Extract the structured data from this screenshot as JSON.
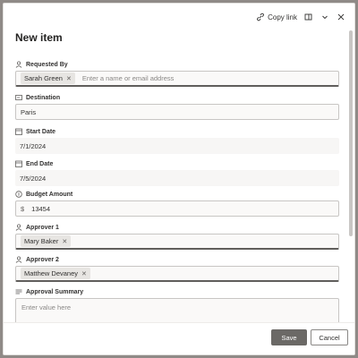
{
  "topbar": {
    "copy_link": "Copy link"
  },
  "form": {
    "title": "New item",
    "requested_by": {
      "label": "Requested By",
      "value": "Sarah Green",
      "placeholder": "Enter a name or email address"
    },
    "destination": {
      "label": "Destination",
      "value": "Paris"
    },
    "start_date": {
      "label": "Start Date",
      "value": "7/1/2024"
    },
    "end_date": {
      "label": "End Date",
      "value": "7/5/2024"
    },
    "budget": {
      "label": "Budget Amount",
      "currency": "$",
      "value": "13454"
    },
    "approver1": {
      "label": "Approver 1",
      "value": "Mary Baker"
    },
    "approver2": {
      "label": "Approver 2",
      "value": "Matthew Devaney"
    },
    "summary": {
      "label": "Approval Summary",
      "placeholder": "Enter value here"
    }
  },
  "footer": {
    "save_label": "Save",
    "cancel_label": "Cancel"
  }
}
